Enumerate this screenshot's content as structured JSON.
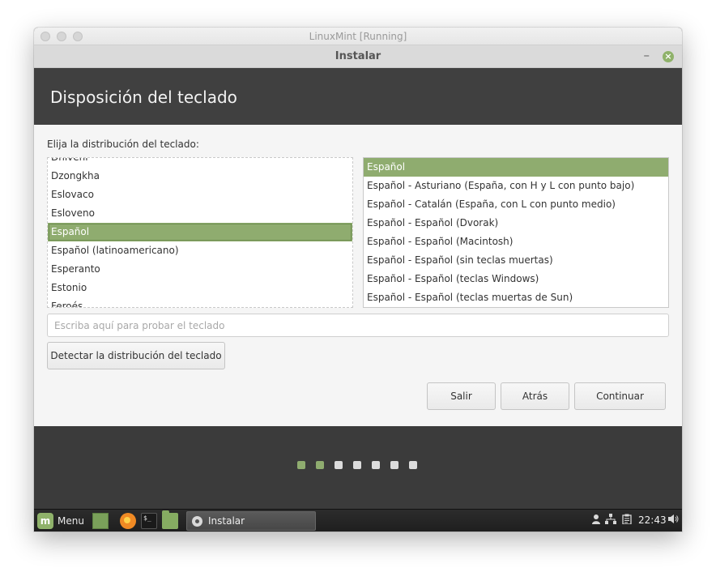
{
  "mac": {
    "title": "LinuxMint [Running]"
  },
  "installer": {
    "window_title": "Instalar",
    "minimize_glyph": "–",
    "close_glyph": "×",
    "header_title": "Disposición del teclado",
    "prompt": "Elija la distribución del teclado:",
    "layouts": [
      "Dhivehi",
      "Dzongkha",
      "Eslovaco",
      "Esloveno",
      "Español",
      "Español (latinoamericano)",
      "Esperanto",
      "Estonio",
      "Feroés"
    ],
    "layouts_selected": "Español",
    "variants": [
      "Español",
      "Español - Asturiano (España, con H y L con punto bajo)",
      "Español - Catalán (España, con L con punto medio)",
      "Español - Español (Dvorak)",
      "Español - Español (Macintosh)",
      "Español - Español (sin teclas muertas)",
      "Español - Español (teclas Windows)",
      "Español - Español (teclas muertas de Sun)"
    ],
    "variants_selected": "Español",
    "test_placeholder": "Escriba aquí para probar el teclado",
    "detect_label": "Detectar la distribución del teclado",
    "quit_label": "Salir",
    "back_label": "Atrás",
    "continue_label": "Continuar",
    "progress": {
      "total_steps": 7,
      "completed_steps": 2
    }
  },
  "taskbar": {
    "menu_label": "Menu",
    "terminal_glyph": "$_",
    "task_label": "Instalar",
    "clock": "22:43",
    "icons": [
      "linuxmint-logo-icon",
      "show-desktop-icon",
      "firefox-icon",
      "terminal-icon",
      "files-icon",
      "user-icon",
      "network-icon",
      "clipboard-icon",
      "volume-icon"
    ]
  },
  "colors": {
    "accent": "#8fac6f",
    "header": "#404040",
    "footer": "#3b3b3b"
  }
}
